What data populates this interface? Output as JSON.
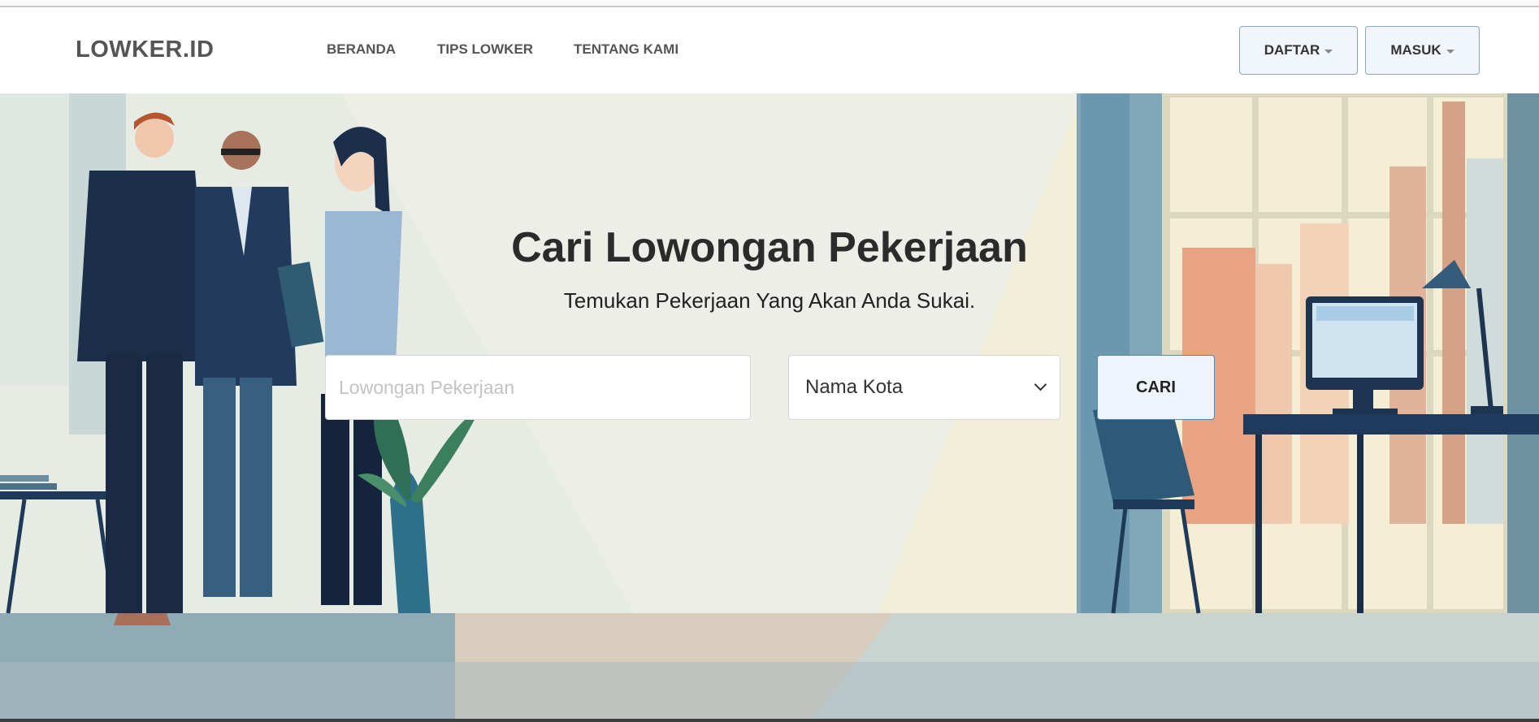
{
  "navbar": {
    "brand": "LOWKER.ID",
    "links": [
      "BERANDA",
      "TIPS LOWKER",
      "TENTANG KAMI"
    ],
    "register_label": "DAFTAR",
    "login_label": "MASUK"
  },
  "hero": {
    "title": "Cari Lowongan Pekerjaan",
    "subtitle": "Temukan Pekerjaan Yang Akan Anda Sukai.",
    "job_input": {
      "placeholder": "Lowongan Pekerjaan",
      "value": ""
    },
    "city_select": {
      "selected": "Nama Kota"
    },
    "search_label": "CARI"
  },
  "colors": {
    "brand_text": "#555555",
    "button_bg": "#f1f6fc",
    "button_border": "#8ea4b8",
    "search_border": "#5a86a8"
  }
}
